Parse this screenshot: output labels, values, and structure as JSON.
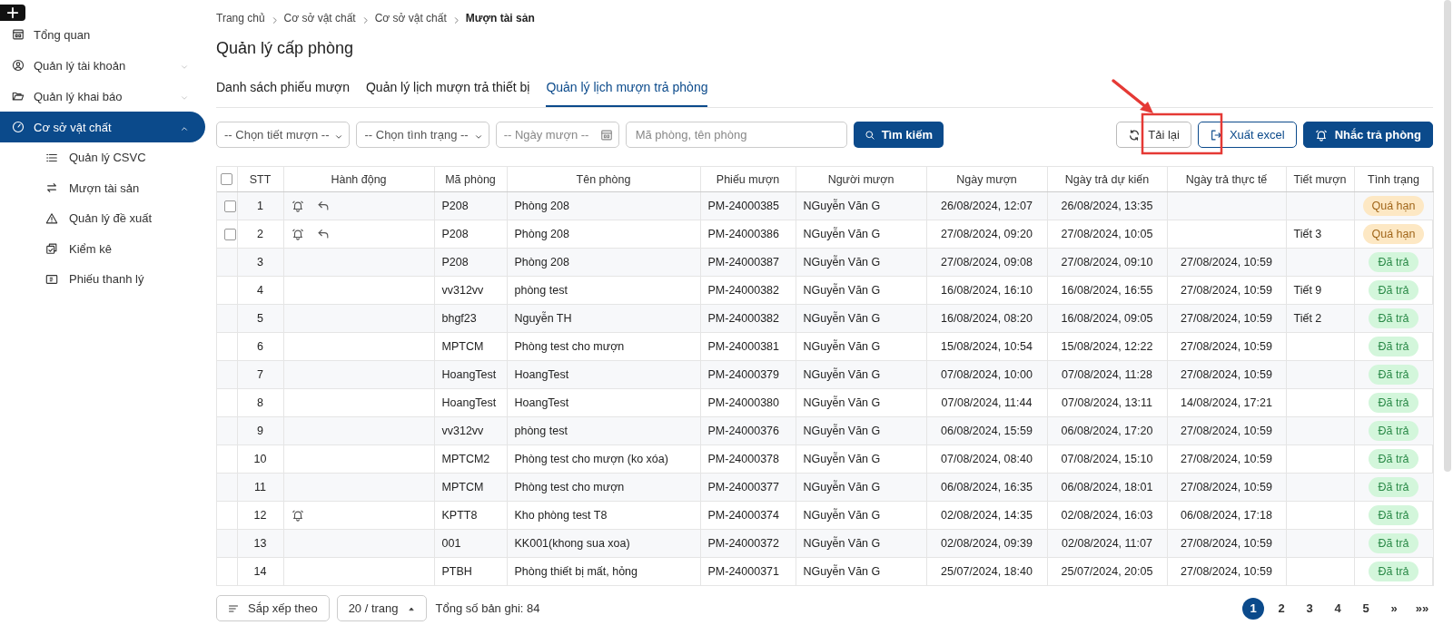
{
  "sidebar": {
    "items": [
      {
        "label": "Tổng quan",
        "expandable": false,
        "selected": false
      },
      {
        "label": "Quản lý tài khoản",
        "expandable": true,
        "expanded": false,
        "selected": false
      },
      {
        "label": "Quản lý khai báo",
        "expandable": true,
        "expanded": false,
        "selected": false
      },
      {
        "label": "Cơ sở vật chất",
        "expandable": true,
        "expanded": true,
        "selected": true,
        "children": [
          {
            "label": "Quản lý CSVC"
          },
          {
            "label": "Mượn tài sản"
          },
          {
            "label": "Quản lý đề xuất"
          },
          {
            "label": "Kiểm kê"
          },
          {
            "label": "Phiếu thanh lý"
          }
        ]
      }
    ]
  },
  "breadcrumb": [
    "Trang chủ",
    "Cơ sở vật chất",
    "Cơ sở vật chất",
    "Mượn tài sản"
  ],
  "page_title": "Quản lý cấp phòng",
  "tabs": [
    {
      "label": "Danh sách phiếu mượn",
      "selected": false
    },
    {
      "label": "Quản lý lịch mượn trả thiết bị",
      "selected": false
    },
    {
      "label": "Quản lý lịch mượn trả phòng",
      "selected": true
    }
  ],
  "filters": {
    "period_select": "-- Chọn tiết mượn --",
    "status_select": "-- Chọn tình trạng --",
    "date_placeholder": "-- Ngày mượn --",
    "search_placeholder": "Mã phòng, tên phòng",
    "search_button": "Tìm kiếm"
  },
  "actions": [
    {
      "label": "Tải lại",
      "kind": "reload"
    },
    {
      "label": "Xuất excel",
      "kind": "export"
    },
    {
      "label": "Nhắc trả phòng",
      "kind": "remind"
    }
  ],
  "table": {
    "columns": [
      "STT",
      "Hành động",
      "Mã phòng",
      "Tên phòng",
      "Phiếu mượn",
      "Người mượn",
      "Ngày mượn",
      "Ngày trả dự kiến",
      "Ngày trả thực tế",
      "Tiết mượn",
      "Tình trạng"
    ],
    "header_checkbox": {
      "checked": false
    },
    "rows": [
      {
        "stt": "1",
        "checkbox": {
          "checked": false
        },
        "can_remind": true,
        "can_return": true,
        "code": "P208",
        "name": "Phòng 208",
        "ticket": "PM-24000385",
        "borrower": "NGuyễn Văn G",
        "borrow_date": "26/08/2024, 12:07",
        "due_date": "26/08/2024, 13:35",
        "return_date": "",
        "period": "",
        "status": {
          "label": "Quá hạn",
          "kind": "overdue"
        }
      },
      {
        "stt": "2",
        "checkbox": {
          "checked": false
        },
        "can_remind": true,
        "can_return": true,
        "code": "P208",
        "name": "Phòng 208",
        "ticket": "PM-24000386",
        "borrower": "NGuyễn Văn G",
        "borrow_date": "27/08/2024, 09:20",
        "due_date": "27/08/2024, 10:05",
        "return_date": "",
        "period": "Tiết 3",
        "status": {
          "label": "Quá hạn",
          "kind": "overdue"
        }
      },
      {
        "stt": "3",
        "code": "P208",
        "name": "Phòng 208",
        "ticket": "PM-24000387",
        "borrower": "NGuyễn Văn G",
        "borrow_date": "27/08/2024, 09:08",
        "due_date": "27/08/2024, 09:10",
        "return_date": "27/08/2024, 10:59",
        "period": "",
        "status": {
          "label": "Đã trả",
          "kind": "returned"
        }
      },
      {
        "stt": "4",
        "code": "vv312vv",
        "name": "phòng test",
        "ticket": "PM-24000382",
        "borrower": "NGuyễn Văn G",
        "borrow_date": "16/08/2024, 16:10",
        "due_date": "16/08/2024, 16:55",
        "return_date": "27/08/2024, 10:59",
        "period": "Tiết 9",
        "status": {
          "label": "Đã trả",
          "kind": "returned"
        }
      },
      {
        "stt": "5",
        "code": "bhgf23",
        "name": "Nguyễn TH",
        "ticket": "PM-24000382",
        "borrower": "NGuyễn Văn G",
        "borrow_date": "16/08/2024, 08:20",
        "due_date": "16/08/2024, 09:05",
        "return_date": "27/08/2024, 10:59",
        "period": "Tiết 2",
        "status": {
          "label": "Đã trả",
          "kind": "returned"
        }
      },
      {
        "stt": "6",
        "code": "MPTCM",
        "name": "Phòng test cho mượn",
        "ticket": "PM-24000381",
        "borrower": "NGuyễn Văn G",
        "borrow_date": "15/08/2024, 10:54",
        "due_date": "15/08/2024, 12:22",
        "return_date": "27/08/2024, 10:59",
        "period": "",
        "status": {
          "label": "Đã trả",
          "kind": "returned"
        }
      },
      {
        "stt": "7",
        "code": "HoangTest",
        "name": "HoangTest",
        "ticket": "PM-24000379",
        "borrower": "NGuyễn Văn G",
        "borrow_date": "07/08/2024, 10:00",
        "due_date": "07/08/2024, 11:28",
        "return_date": "27/08/2024, 10:59",
        "period": "",
        "status": {
          "label": "Đã trả",
          "kind": "returned"
        }
      },
      {
        "stt": "8",
        "code": "HoangTest",
        "name": "HoangTest",
        "ticket": "PM-24000380",
        "borrower": "NGuyễn Văn G",
        "borrow_date": "07/08/2024, 11:44",
        "due_date": "07/08/2024, 13:11",
        "return_date": "14/08/2024, 17:21",
        "period": "",
        "status": {
          "label": "Đã trả",
          "kind": "returned"
        }
      },
      {
        "stt": "9",
        "code": "vv312vv",
        "name": "phòng test",
        "ticket": "PM-24000376",
        "borrower": "NGuyễn Văn G",
        "borrow_date": "06/08/2024, 15:59",
        "due_date": "06/08/2024, 17:20",
        "return_date": "27/08/2024, 10:59",
        "period": "",
        "status": {
          "label": "Đã trả",
          "kind": "returned"
        }
      },
      {
        "stt": "10",
        "code": "MPTCM2",
        "name": "Phòng test cho mượn (ko xóa)",
        "ticket": "PM-24000378",
        "borrower": "NGuyễn Văn G",
        "borrow_date": "07/08/2024, 08:40",
        "due_date": "07/08/2024, 15:10",
        "return_date": "27/08/2024, 10:59",
        "period": "",
        "status": {
          "label": "Đã trả",
          "kind": "returned"
        }
      },
      {
        "stt": "11",
        "code": "MPTCM",
        "name": "Phòng test cho mượn",
        "ticket": "PM-24000377",
        "borrower": "NGuyễn Văn G",
        "borrow_date": "06/08/2024, 16:35",
        "due_date": "06/08/2024, 18:01",
        "return_date": "27/08/2024, 10:59",
        "period": "",
        "status": {
          "label": "Đã trả",
          "kind": "returned"
        }
      },
      {
        "stt": "12",
        "can_remind": true,
        "can_return": false,
        "code": "KPTT8",
        "name": "Kho phòng test T8",
        "ticket": "PM-24000374",
        "borrower": "NGuyễn Văn G",
        "borrow_date": "02/08/2024, 14:35",
        "due_date": "02/08/2024, 16:03",
        "return_date": "06/08/2024, 17:18",
        "period": "",
        "status": {
          "label": "Đã trả",
          "kind": "returned"
        }
      },
      {
        "stt": "13",
        "code": "001",
        "name": "KK001(khong sua xoa)",
        "ticket": "PM-24000372",
        "borrower": "NGuyễn Văn G",
        "borrow_date": "02/08/2024, 09:39",
        "due_date": "02/08/2024, 11:07",
        "return_date": "27/08/2024, 10:59",
        "period": "",
        "status": {
          "label": "Đã trả",
          "kind": "returned"
        }
      },
      {
        "stt": "14",
        "code": "PTBH",
        "name": "Phòng thiết bị mất, hỏng",
        "ticket": "PM-24000371",
        "borrower": "NGuyễn Văn G",
        "borrow_date": "25/07/2024, 18:40",
        "due_date": "25/07/2024, 20:05",
        "return_date": "27/08/2024, 10:59",
        "period": "",
        "status": {
          "label": "Đã trả",
          "kind": "returned"
        }
      }
    ]
  },
  "footer": {
    "sort_button": "Sắp xếp theo",
    "page_size": "20 / trang",
    "total": "Tổng số bản ghi: 84",
    "pages": [
      {
        "label": "1",
        "selected": true
      },
      {
        "label": "2",
        "selected": false
      },
      {
        "label": "3",
        "selected": false
      },
      {
        "label": "4",
        "selected": false
      },
      {
        "label": "5",
        "selected": false
      }
    ],
    "next": "»",
    "last": "»»"
  }
}
